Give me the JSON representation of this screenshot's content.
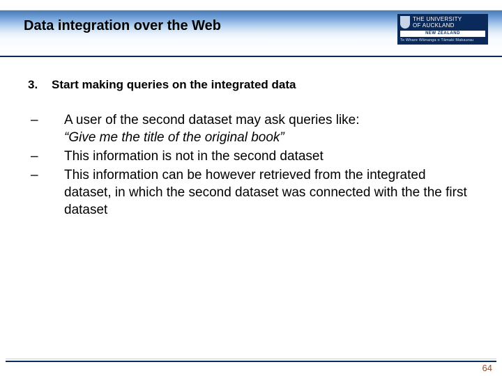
{
  "header": {
    "title": "Data integration over the Web",
    "logo": {
      "line1": "THE UNIVERSITY",
      "line2": "OF AUCKLAND",
      "nz": "NEW ZEALAND",
      "tagline": "Te Whare Wānanga o Tāmaki Makaurau"
    }
  },
  "step": {
    "number": "3.",
    "text": "Start making queries on the integrated data"
  },
  "bullets": [
    {
      "line1": "A user of the second dataset may ask queries like:",
      "line2_italic": "“Give me the title of the original book”"
    },
    {
      "line1": "This information is not in the second dataset"
    },
    {
      "line1": "This information can be however retrieved from the integrated dataset, in which the second dataset was connected with the the first dataset"
    }
  ],
  "page_number": "64"
}
